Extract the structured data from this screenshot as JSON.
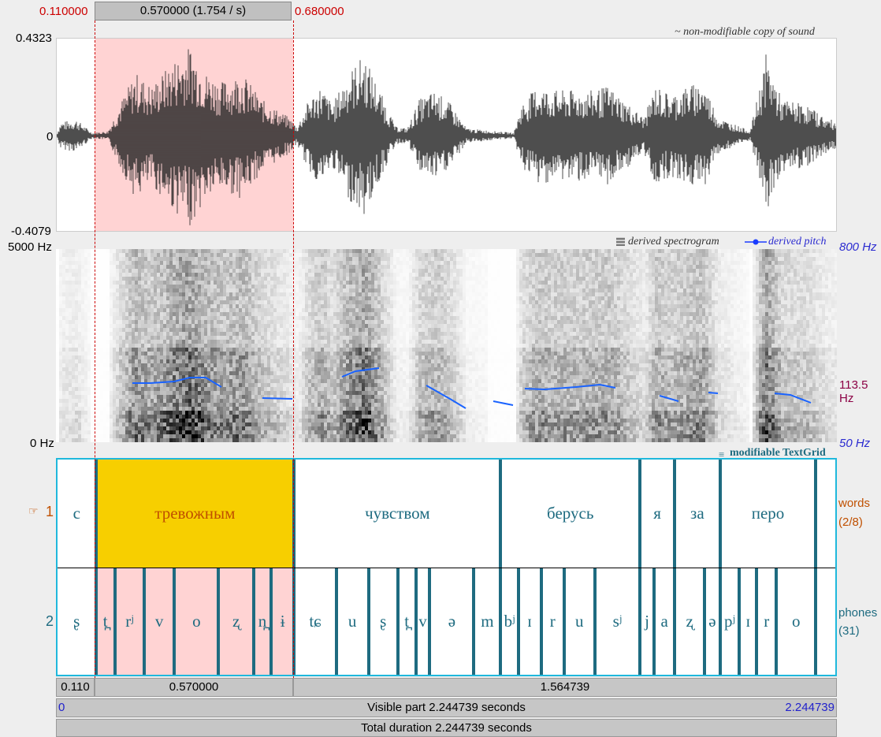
{
  "selection": {
    "start": "0.110000",
    "end": "0.680000",
    "length_label": "0.570000 (1.754 / s)"
  },
  "waveform": {
    "ymax": "0.4323",
    "ymid": "0",
    "ymin": "-0.4079",
    "caption": "~ non-modifiable copy of sound"
  },
  "spectrogram": {
    "fmax": "5000 Hz",
    "fmin": "0 Hz",
    "caption_spec": "derived spectrogram",
    "caption_pitch": "derived pitch",
    "pitch_top": "800 Hz",
    "pitch_cursor": "113.5 Hz",
    "pitch_bottom": "50 Hz"
  },
  "textgrid": {
    "caption": "modifiable TextGrid",
    "tier1": {
      "number": "1",
      "name": "words",
      "count": "(2/8)"
    },
    "tier2": {
      "number": "2",
      "name": "phones",
      "count": "(31)"
    },
    "words": [
      {
        "text": "с",
        "t0": 0.0,
        "t1": 0.11
      },
      {
        "text": "тревожным",
        "t0": 0.11,
        "t1": 0.68,
        "selected": true
      },
      {
        "text": "чувством",
        "t0": 0.68,
        "t1": 1.274
      },
      {
        "text": "берусь",
        "t0": 1.274,
        "t1": 1.674
      },
      {
        "text": "я",
        "t0": 1.674,
        "t1": 1.774
      },
      {
        "text": "за",
        "t0": 1.774,
        "t1": 1.904
      },
      {
        "text": "перо",
        "t0": 1.904,
        "t1": 2.18
      },
      {
        "text": "",
        "t0": 2.18,
        "t1": 2.244739
      }
    ],
    "phones": [
      {
        "text": "ʂ",
        "t0": 0.0,
        "t1": 0.11
      },
      {
        "text": "t̪",
        "t0": 0.11,
        "t1": 0.165
      },
      {
        "text": "rʲ",
        "t0": 0.165,
        "t1": 0.249
      },
      {
        "text": "v",
        "t0": 0.249,
        "t1": 0.336
      },
      {
        "text": "o",
        "t0": 0.336,
        "t1": 0.463
      },
      {
        "text": "ʐ",
        "t0": 0.463,
        "t1": 0.564
      },
      {
        "text": "n̪",
        "t0": 0.564,
        "t1": 0.614
      },
      {
        "text": "ɨ",
        "t0": 0.614,
        "t1": 0.68
      },
      {
        "text": "tɕ",
        "t0": 0.68,
        "t1": 0.801
      },
      {
        "text": "u",
        "t0": 0.801,
        "t1": 0.894
      },
      {
        "text": "ʂ",
        "t0": 0.894,
        "t1": 0.978
      },
      {
        "text": "t̪",
        "t0": 0.978,
        "t1": 1.03
      },
      {
        "text": "v",
        "t0": 1.03,
        "t1": 1.07
      },
      {
        "text": "ə",
        "t0": 1.07,
        "t1": 1.197
      },
      {
        "text": "m",
        "t0": 1.197,
        "t1": 1.274
      },
      {
        "text": "bʲ",
        "t0": 1.274,
        "t1": 1.324
      },
      {
        "text": "ɪ",
        "t0": 1.324,
        "t1": 1.39
      },
      {
        "text": "r",
        "t0": 1.39,
        "t1": 1.456
      },
      {
        "text": "u",
        "t0": 1.456,
        "t1": 1.544
      },
      {
        "text": "sʲ",
        "t0": 1.544,
        "t1": 1.674
      },
      {
        "text": "j",
        "t0": 1.674,
        "t1": 1.715
      },
      {
        "text": "a",
        "t0": 1.715,
        "t1": 1.774
      },
      {
        "text": "ʐ",
        "t0": 1.774,
        "t1": 1.86
      },
      {
        "text": "ə",
        "t0": 1.86,
        "t1": 1.904
      },
      {
        "text": "pʲ",
        "t0": 1.904,
        "t1": 1.96
      },
      {
        "text": "ɪ",
        "t0": 1.96,
        "t1": 2.01
      },
      {
        "text": "r",
        "t0": 2.01,
        "t1": 2.066
      },
      {
        "text": "o",
        "t0": 2.066,
        "t1": 2.18
      },
      {
        "text": "",
        "t0": 2.18,
        "t1": 2.244739
      }
    ]
  },
  "durations": {
    "before": "0.110",
    "selected": "0.570000",
    "after": "1.564739",
    "visible_start": "0",
    "visible_label": "Visible part 2.244739 seconds",
    "visible_end": "2.244739",
    "total_label": "Total duration 2.244739 seconds"
  },
  "colors": {
    "selection_fill": "#ffd3d3",
    "word_selected": "#f7cf00",
    "tier_border": "#1fb8dc",
    "boundary": "#1e6b80",
    "pitch": "#1a63ff",
    "cursor_red": "#cc0000"
  }
}
